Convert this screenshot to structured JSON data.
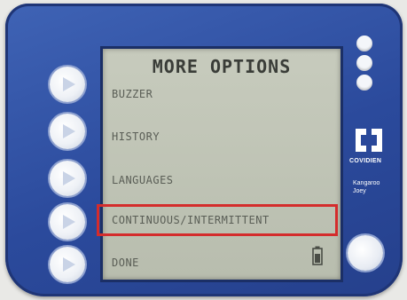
{
  "screen": {
    "title": "MORE OPTIONS",
    "menu_items": [
      "BUZZER",
      "HISTORY",
      "LANGUAGES",
      "CONTINUOUS/INTERMITTENT",
      "DONE"
    ],
    "highlighted_item": "CONTINUOUS/INTERMITTENT",
    "highlight_color": "#d42c2c"
  },
  "branding": {
    "company": "COVIDIEN",
    "model_line1": "Kangaroo",
    "model_line2": "Joey"
  },
  "icons": {
    "side_buttons": "play-arrow-icon",
    "battery": "battery-icon",
    "logo": "covidien-logo-icon",
    "indicators": "indicator-dot-icon"
  },
  "colors": {
    "device_blue": "#2b4a9c",
    "lcd_background": "#bfc3b5"
  }
}
